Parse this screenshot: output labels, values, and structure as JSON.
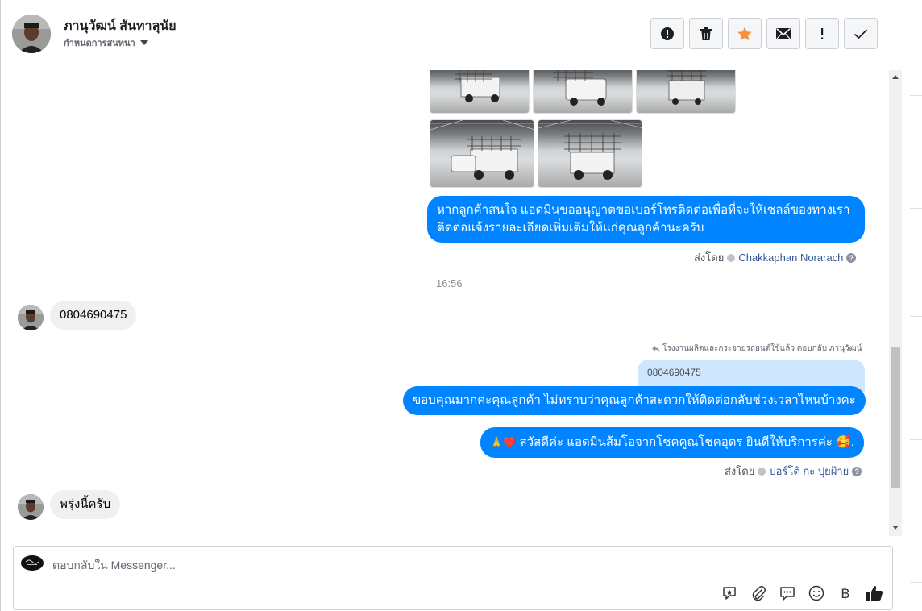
{
  "header": {
    "name": "ภานุวัฒน์ สันทาลุนัย",
    "subtitle": "กำหนดการสนทนา",
    "actions": [
      {
        "name": "spam-icon",
        "glyph": "!"
      },
      {
        "name": "trash-icon",
        "glyph": ""
      },
      {
        "name": "star-icon",
        "glyph": ""
      },
      {
        "name": "envelope-icon",
        "glyph": ""
      },
      {
        "name": "exclamation-icon",
        "glyph": "!"
      },
      {
        "name": "check-icon",
        "glyph": ""
      }
    ],
    "star_color": "#f7923b"
  },
  "messages": {
    "out_1": "หากลูกค้าสนใจ แอดมินขออนุญาตขอเบอร์โทรติดต่อเพื่อที่จะให้เซลล์ของทางเราติดต่อแจ้งรายละเอียดเพิ่มเติมให้แก่คุณลูกค้านะครับ",
    "out_1_sent_by_label": "ส่งโดย",
    "out_1_agent": "Chakkaphan Norarach",
    "time_1": "16:56",
    "in_1": "0804690475",
    "reply_context": "โรงงานผลิตและกระจายรถยนต์ใช้แล้ว ตอบกลับ ภานุวัฒน์",
    "reply_quote": "0804690475",
    "out_2": "ขอบคุณมากค่ะคุณลูกค้า ไม่ทราบว่าคุณลูกค้าสะดวกให้ติดต่อกลับช่วงเวลาไหนบ้างคะ",
    "out_3_emoji_prefix": "🙏❤️",
    "out_3": "สวัสดีค่ะ แอดมินส้มโอจากโชคคูณโชคอุดร ยินดีให้บริการค่ะ",
    "out_3_emoji_suffix": "🥰.",
    "out_3_sent_by_label": "ส่งโดย",
    "out_3_agent": "ปอร์โต้ กะ ปุยฝ้าย",
    "in_2": "พรุ่งนี้ครับ"
  },
  "composer": {
    "placeholder": "ตอบกลับใน Messenger...",
    "tools": [
      "sticker-icon",
      "attachment-icon",
      "saved-reply-icon",
      "emoji-icon",
      "payment-icon",
      "like-icon"
    ],
    "baht_glyph": "฿"
  },
  "colors": {
    "outgoing_bubble": "#0084ff",
    "incoming_bubble": "#f0f0f0",
    "reply_quote": "#cfe6ff"
  }
}
